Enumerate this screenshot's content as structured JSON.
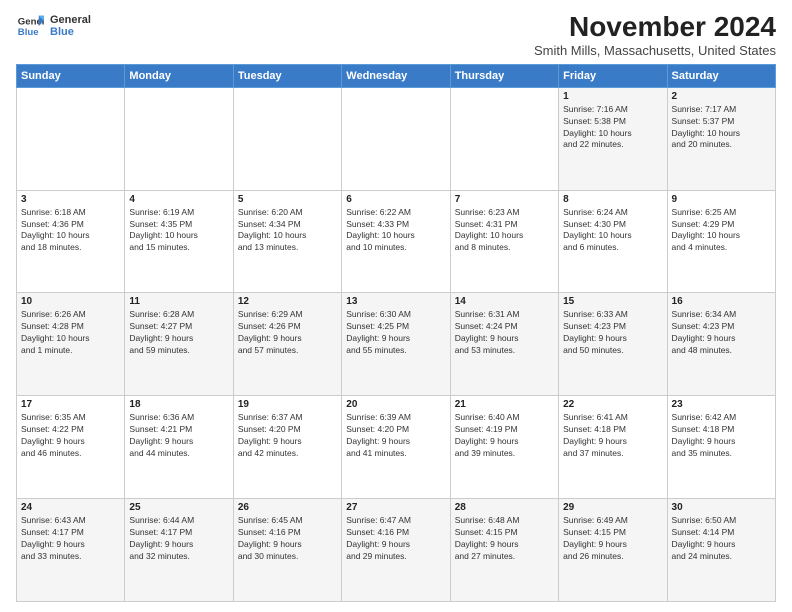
{
  "logo": {
    "line1": "General",
    "line2": "Blue"
  },
  "header": {
    "month": "November 2024",
    "location": "Smith Mills, Massachusetts, United States"
  },
  "weekdays": [
    "Sunday",
    "Monday",
    "Tuesday",
    "Wednesday",
    "Thursday",
    "Friday",
    "Saturday"
  ],
  "weeks": [
    [
      {
        "day": "",
        "info": ""
      },
      {
        "day": "",
        "info": ""
      },
      {
        "day": "",
        "info": ""
      },
      {
        "day": "",
        "info": ""
      },
      {
        "day": "",
        "info": ""
      },
      {
        "day": "1",
        "info": "Sunrise: 7:16 AM\nSunset: 5:38 PM\nDaylight: 10 hours\nand 22 minutes."
      },
      {
        "day": "2",
        "info": "Sunrise: 7:17 AM\nSunset: 5:37 PM\nDaylight: 10 hours\nand 20 minutes."
      }
    ],
    [
      {
        "day": "3",
        "info": "Sunrise: 6:18 AM\nSunset: 4:36 PM\nDaylight: 10 hours\nand 18 minutes."
      },
      {
        "day": "4",
        "info": "Sunrise: 6:19 AM\nSunset: 4:35 PM\nDaylight: 10 hours\nand 15 minutes."
      },
      {
        "day": "5",
        "info": "Sunrise: 6:20 AM\nSunset: 4:34 PM\nDaylight: 10 hours\nand 13 minutes."
      },
      {
        "day": "6",
        "info": "Sunrise: 6:22 AM\nSunset: 4:33 PM\nDaylight: 10 hours\nand 10 minutes."
      },
      {
        "day": "7",
        "info": "Sunrise: 6:23 AM\nSunset: 4:31 PM\nDaylight: 10 hours\nand 8 minutes."
      },
      {
        "day": "8",
        "info": "Sunrise: 6:24 AM\nSunset: 4:30 PM\nDaylight: 10 hours\nand 6 minutes."
      },
      {
        "day": "9",
        "info": "Sunrise: 6:25 AM\nSunset: 4:29 PM\nDaylight: 10 hours\nand 4 minutes."
      }
    ],
    [
      {
        "day": "10",
        "info": "Sunrise: 6:26 AM\nSunset: 4:28 PM\nDaylight: 10 hours\nand 1 minute."
      },
      {
        "day": "11",
        "info": "Sunrise: 6:28 AM\nSunset: 4:27 PM\nDaylight: 9 hours\nand 59 minutes."
      },
      {
        "day": "12",
        "info": "Sunrise: 6:29 AM\nSunset: 4:26 PM\nDaylight: 9 hours\nand 57 minutes."
      },
      {
        "day": "13",
        "info": "Sunrise: 6:30 AM\nSunset: 4:25 PM\nDaylight: 9 hours\nand 55 minutes."
      },
      {
        "day": "14",
        "info": "Sunrise: 6:31 AM\nSunset: 4:24 PM\nDaylight: 9 hours\nand 53 minutes."
      },
      {
        "day": "15",
        "info": "Sunrise: 6:33 AM\nSunset: 4:23 PM\nDaylight: 9 hours\nand 50 minutes."
      },
      {
        "day": "16",
        "info": "Sunrise: 6:34 AM\nSunset: 4:23 PM\nDaylight: 9 hours\nand 48 minutes."
      }
    ],
    [
      {
        "day": "17",
        "info": "Sunrise: 6:35 AM\nSunset: 4:22 PM\nDaylight: 9 hours\nand 46 minutes."
      },
      {
        "day": "18",
        "info": "Sunrise: 6:36 AM\nSunset: 4:21 PM\nDaylight: 9 hours\nand 44 minutes."
      },
      {
        "day": "19",
        "info": "Sunrise: 6:37 AM\nSunset: 4:20 PM\nDaylight: 9 hours\nand 42 minutes."
      },
      {
        "day": "20",
        "info": "Sunrise: 6:39 AM\nSunset: 4:20 PM\nDaylight: 9 hours\nand 41 minutes."
      },
      {
        "day": "21",
        "info": "Sunrise: 6:40 AM\nSunset: 4:19 PM\nDaylight: 9 hours\nand 39 minutes."
      },
      {
        "day": "22",
        "info": "Sunrise: 6:41 AM\nSunset: 4:18 PM\nDaylight: 9 hours\nand 37 minutes."
      },
      {
        "day": "23",
        "info": "Sunrise: 6:42 AM\nSunset: 4:18 PM\nDaylight: 9 hours\nand 35 minutes."
      }
    ],
    [
      {
        "day": "24",
        "info": "Sunrise: 6:43 AM\nSunset: 4:17 PM\nDaylight: 9 hours\nand 33 minutes."
      },
      {
        "day": "25",
        "info": "Sunrise: 6:44 AM\nSunset: 4:17 PM\nDaylight: 9 hours\nand 32 minutes."
      },
      {
        "day": "26",
        "info": "Sunrise: 6:45 AM\nSunset: 4:16 PM\nDaylight: 9 hours\nand 30 minutes."
      },
      {
        "day": "27",
        "info": "Sunrise: 6:47 AM\nSunset: 4:16 PM\nDaylight: 9 hours\nand 29 minutes."
      },
      {
        "day": "28",
        "info": "Sunrise: 6:48 AM\nSunset: 4:15 PM\nDaylight: 9 hours\nand 27 minutes."
      },
      {
        "day": "29",
        "info": "Sunrise: 6:49 AM\nSunset: 4:15 PM\nDaylight: 9 hours\nand 26 minutes."
      },
      {
        "day": "30",
        "info": "Sunrise: 6:50 AM\nSunset: 4:14 PM\nDaylight: 9 hours\nand 24 minutes."
      }
    ]
  ]
}
